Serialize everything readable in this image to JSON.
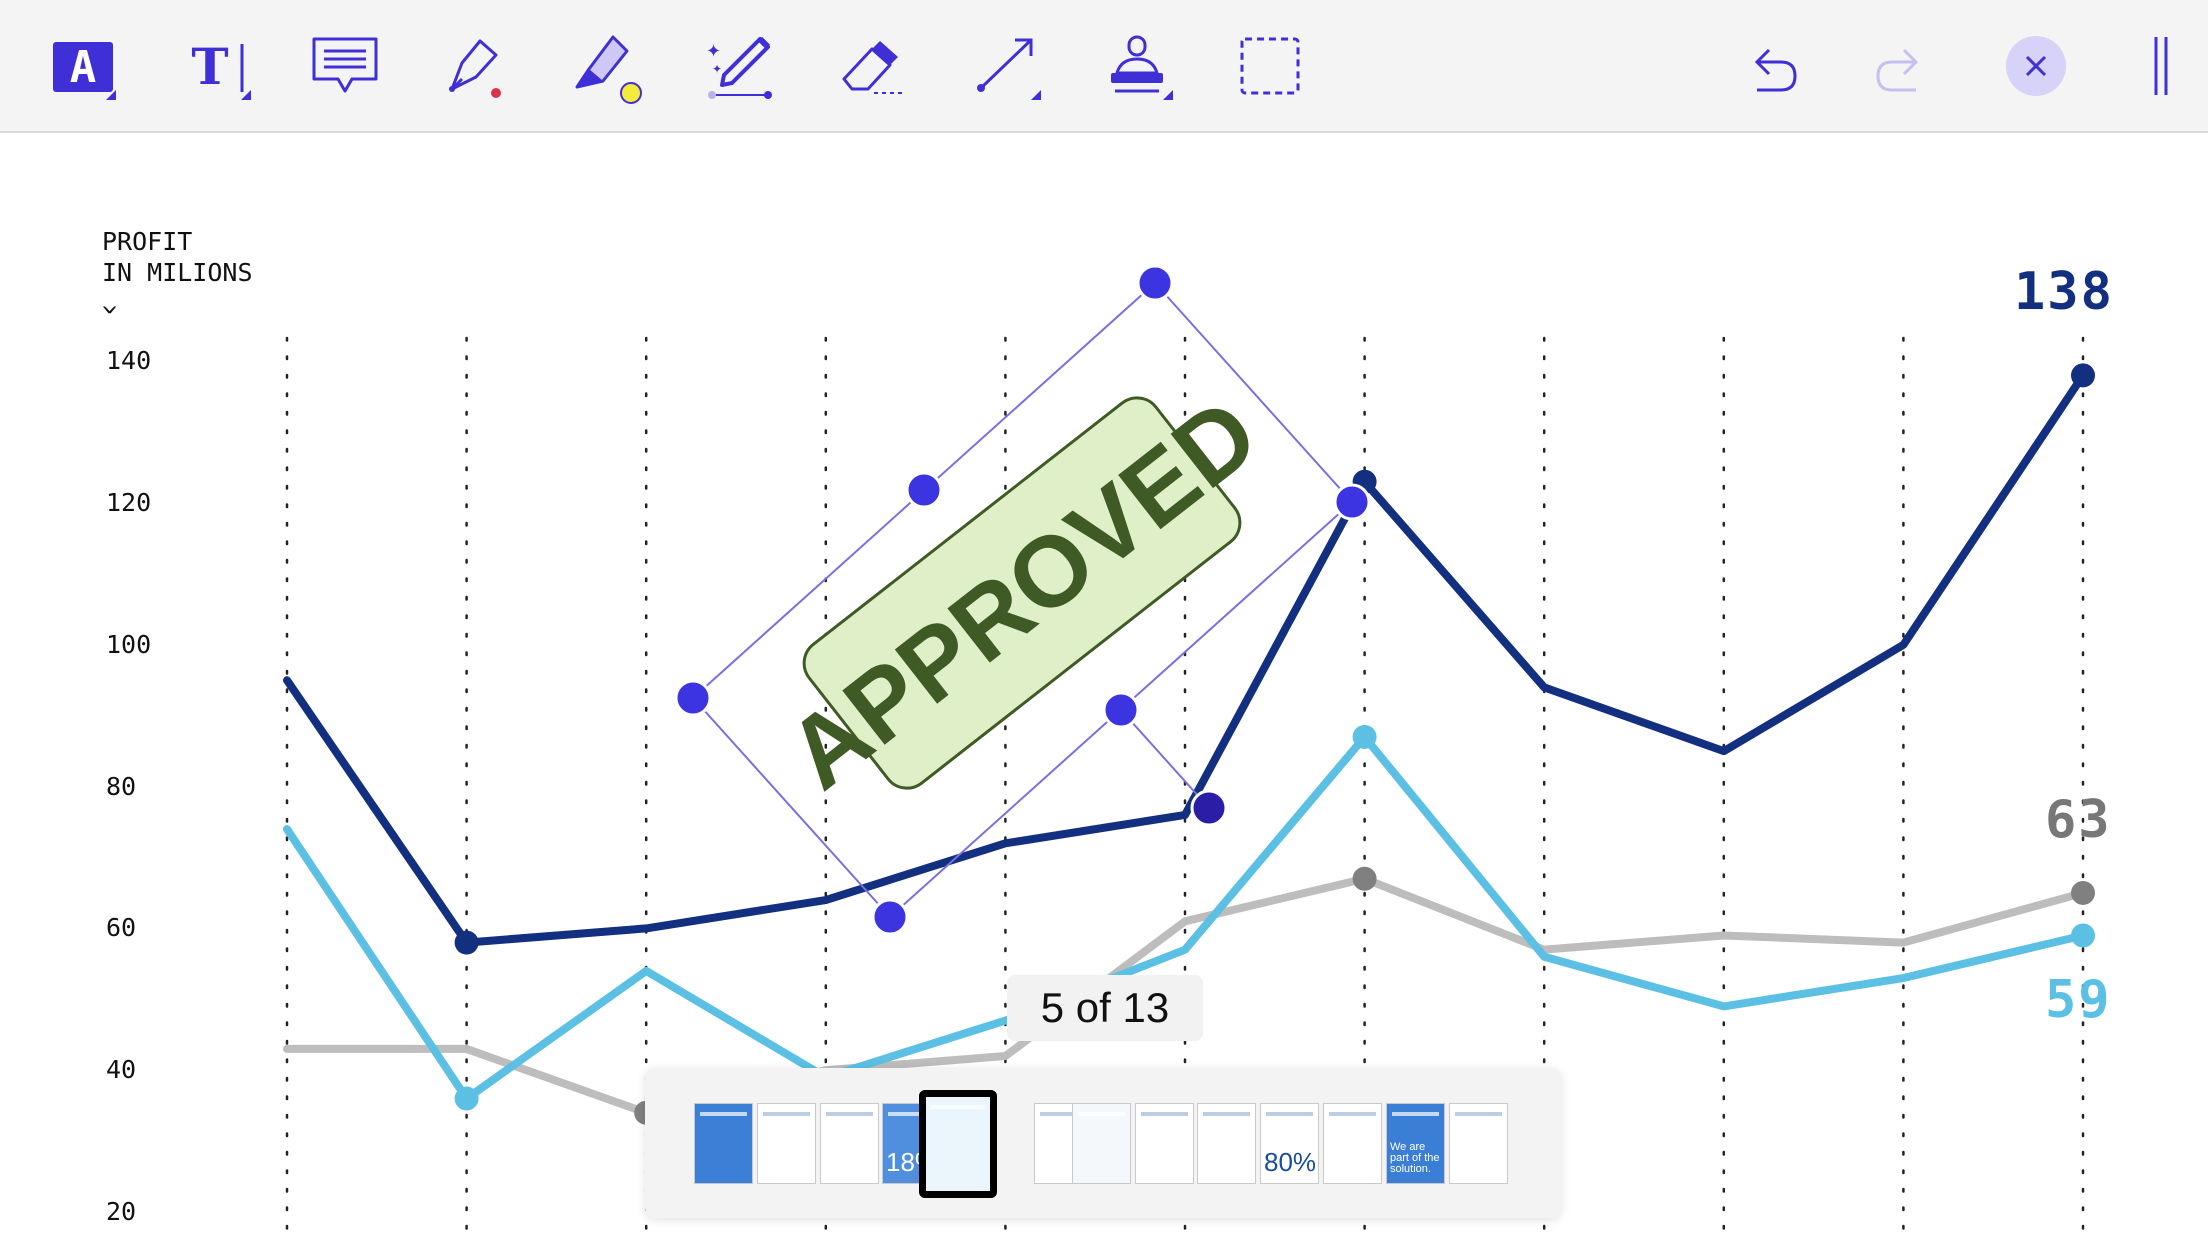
{
  "toolbar": {
    "tools": [
      {
        "name": "text-style-tool",
        "icon": "text-style-icon",
        "glyph": "A"
      },
      {
        "name": "text-tool",
        "icon": "text-cursor-icon",
        "glyph": "T"
      },
      {
        "name": "note-tool",
        "icon": "comment-icon"
      },
      {
        "name": "pen-tool",
        "icon": "pen-icon"
      },
      {
        "name": "highlighter-tool",
        "icon": "highlighter-icon"
      },
      {
        "name": "magic-ink-tool",
        "icon": "magic-pen-icon"
      },
      {
        "name": "eraser-tool",
        "icon": "eraser-icon"
      },
      {
        "name": "line-tool",
        "icon": "line-arrow-icon"
      },
      {
        "name": "stamp-tool",
        "icon": "stamp-icon"
      },
      {
        "name": "selection-tool",
        "icon": "selection-icon"
      }
    ],
    "accent_color": "#3f2fd6"
  },
  "stamp": {
    "text": "APPROVED",
    "fill": "#dff0c8",
    "text_color": "#3f5a25"
  },
  "chart_data": {
    "type": "line",
    "ylabel": "PROFIT\nIN MILIONS",
    "ylabel_lines": [
      "PROFIT",
      "IN MILIONS"
    ],
    "ylabel_arrow": "^",
    "y_ticks": [
      "140",
      "120",
      "100",
      "80",
      "60",
      "40",
      "20"
    ],
    "ylim": [
      16,
      164
    ],
    "x_count": 11,
    "grid": "vertical dotted",
    "series": [
      {
        "color": "#12307f",
        "values": [
          95,
          58,
          60,
          64,
          72,
          76,
          123,
          94,
          85,
          100,
          138
        ],
        "end_label": "138",
        "markers": [
          1,
          6,
          10
        ]
      },
      {
        "color": "#5bc0e3",
        "values": [
          74,
          36,
          54,
          39,
          47,
          57,
          87,
          56,
          49,
          53,
          59
        ],
        "end_label": "59",
        "markers": [
          1,
          6,
          10
        ]
      },
      {
        "color": "#bdbdbd",
        "values": [
          43,
          43,
          34,
          40,
          42,
          61,
          67,
          57,
          59,
          58,
          65
        ],
        "end_label": "63",
        "end_label_color": "#777777",
        "markers": [
          2,
          6,
          10
        ]
      }
    ]
  },
  "pager": {
    "label": "5 of 13",
    "current": 5,
    "total": 13,
    "thumbnails": [
      {
        "bg": "#3c7fd6"
      },
      {
        "bg": "#ffffff"
      },
      {
        "bg": "#ffffff"
      },
      {
        "bg": "#4f8fde",
        "text": "18%"
      },
      {
        "bg": "#eaf5fc"
      },
      {
        "bg": "#ffffff"
      },
      {
        "bg": "#f5f8fb"
      },
      {
        "bg": "#ffffff"
      },
      {
        "bg": "#ffffff"
      },
      {
        "bg": "#ffffff",
        "text": "80%"
      },
      {
        "bg": "#ffffff"
      },
      {
        "bg": "#3a7ed6",
        "text": "We are part of the solution."
      },
      {
        "bg": "#ffffff"
      }
    ]
  }
}
